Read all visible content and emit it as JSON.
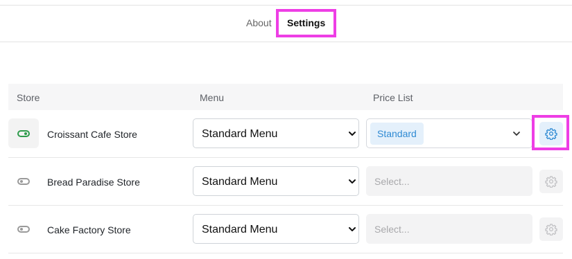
{
  "tabs": {
    "about": "About",
    "settings": "Settings",
    "active": "Settings"
  },
  "table": {
    "headers": {
      "store": "Store",
      "menu": "Menu",
      "price_list": "Price List"
    },
    "rows": [
      {
        "enabled": true,
        "store": "Croissant Cafe Store",
        "menu": "Standard Menu",
        "price_list": "Standard",
        "price_placeholder": ""
      },
      {
        "enabled": false,
        "store": "Bread Paradise Store",
        "menu": "Standard Menu",
        "price_list": "",
        "price_placeholder": "Select..."
      },
      {
        "enabled": false,
        "store": "Cake Factory Store",
        "menu": "Standard Menu",
        "price_list": "",
        "price_placeholder": "Select..."
      }
    ]
  },
  "icons": {
    "toggle": "toggle-switch-icon",
    "dropdown": "chevron-down-icon",
    "settings": "gear-icon"
  },
  "colors": {
    "highlight": "#ee3ee5",
    "accent": "#2f8ad3",
    "accent_bg": "#e4f0fb",
    "toggle_on": "#2e9b4b"
  }
}
